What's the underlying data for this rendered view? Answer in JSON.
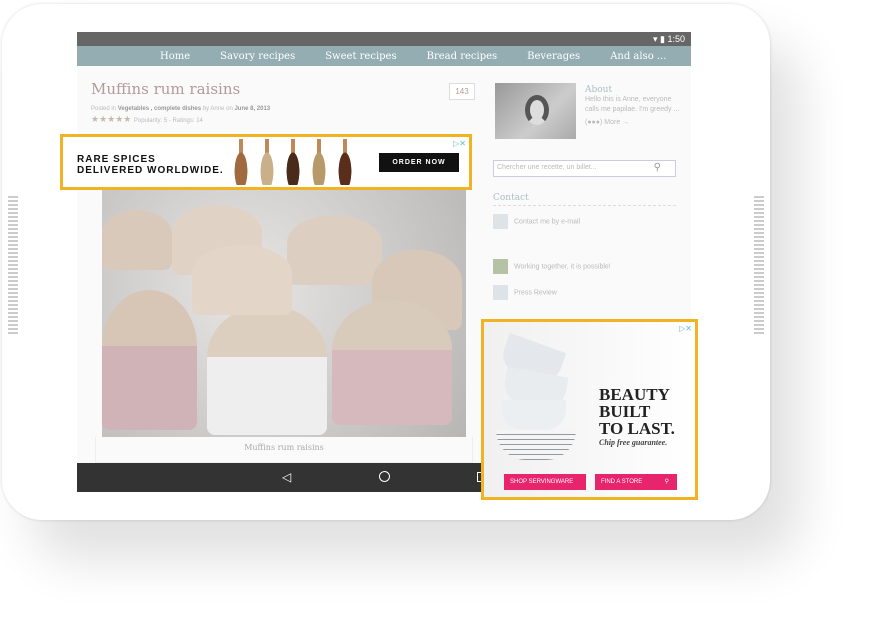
{
  "status": {
    "time": "1:50"
  },
  "nav": [
    "Home",
    "Savory recipes",
    "Sweet recipes",
    "Bread recipes",
    "Beverages",
    "And also ..."
  ],
  "post": {
    "title": "Muffins rum raisins",
    "posted_in": "Posted in",
    "category": "Vegetables , complete dishes",
    "by": "by Anne on",
    "date": "June 8, 2013",
    "stars": "★★★★★",
    "popularity": "Popularity: 5 - Ratings: 14",
    "comments": "143",
    "caption": "Muffins rum raisins"
  },
  "sidebar": {
    "about_title": "About",
    "about_text": "Hello this is Anne, everyone calls me papilae. I'm greedy ...",
    "more": "(●●●) More →",
    "search_placeholder": "Chercher une recette, un billet...",
    "contact_title": "Contact",
    "contact_link": "Contact me by e-mail",
    "working": "Working together, it is possible!",
    "press": "Press Review"
  },
  "ad_banner": {
    "line1": "RARE SPICES",
    "line2": "DELIVERED WORLDWIDE.",
    "cta": "ORDER NOW",
    "close": "▷✕"
  },
  "ad_box": {
    "headline1": "BEAUTY",
    "headline2": "BUILT",
    "headline3": "TO LAST.",
    "tagline": "Chip free guarantee.",
    "btn1": "SHOP SERVINGWARE",
    "btn2": "FIND A STORE",
    "close": "▷✕"
  },
  "colors": {
    "ad_border": "#f0b323",
    "nav": "#93adb3",
    "ad_pink": "#e8246c"
  }
}
